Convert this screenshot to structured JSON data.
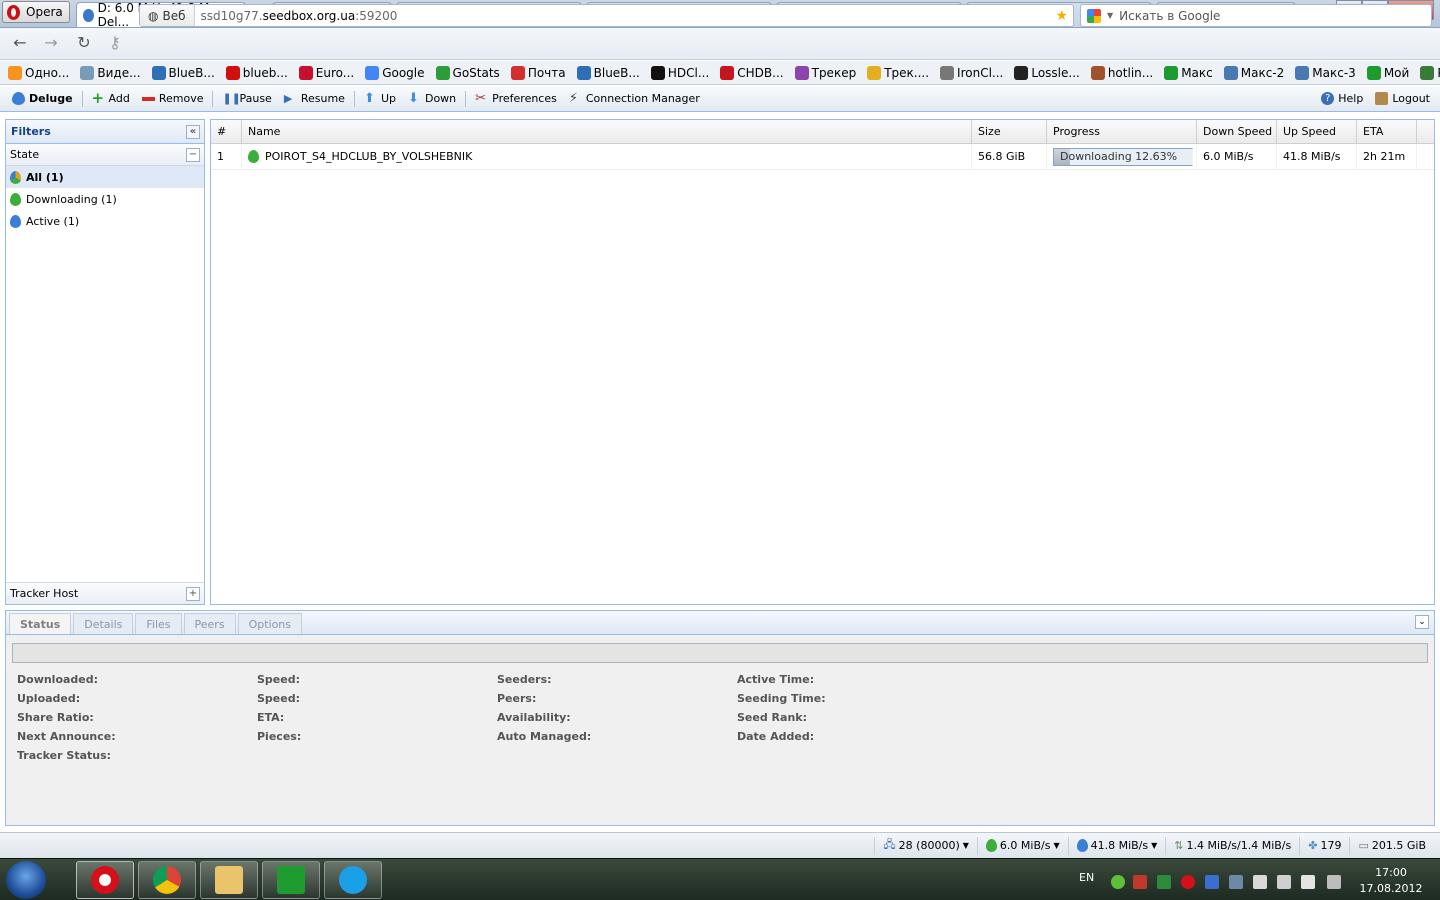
{
  "browser": {
    "menu_label": "Opera",
    "active_tab_title": "D: 6.0 M U: 41.8 M - Del...",
    "tab_close": "×",
    "address_badge": "Веб",
    "url_prefix": "ssd10g77.",
    "url_host": "seedbox.org.ua",
    "url_port": ":59200",
    "search_placeholder": "Искать в Google"
  },
  "bookmarks": [
    {
      "label": "Одно...",
      "color": "#f7931e"
    },
    {
      "label": "Виде...",
      "color": "#7a9bb8"
    },
    {
      "label": "BlueB...",
      "color": "#2f6fb8"
    },
    {
      "label": "blueb...",
      "color": "#d01010"
    },
    {
      "label": "Euro...",
      "color": "#c8102e"
    },
    {
      "label": "Google",
      "color": "#4285f4"
    },
    {
      "label": "GoStats",
      "color": "#2d9c3a"
    },
    {
      "label": "Почта",
      "color": "#d32f2f"
    },
    {
      "label": "BlueB...",
      "color": "#2f6fb8"
    },
    {
      "label": "HDCl...",
      "color": "#111111"
    },
    {
      "label": "CHDB...",
      "color": "#c4161c"
    },
    {
      "label": "Трекер",
      "color": "#8e44ad"
    },
    {
      "label": "Трек....",
      "color": "#e0b020"
    },
    {
      "label": "IronCl...",
      "color": "#777777"
    },
    {
      "label": "Lossle...",
      "color": "#222222"
    },
    {
      "label": "hotlin...",
      "color": "#a0522d"
    },
    {
      "label": "Макс",
      "color": "#1d9b2e"
    },
    {
      "label": "Макс-2",
      "color": "#4a78b0"
    },
    {
      "label": "Макс-3",
      "color": "#4a78b0"
    },
    {
      "label": "Мой",
      "color": "#1d9b2e"
    },
    {
      "label": "Pictur...",
      "color": "#3a7a3a"
    }
  ],
  "toolbar": {
    "brand": "Deluge",
    "add": "Add",
    "remove": "Remove",
    "pause": "Pause",
    "resume": "Resume",
    "up": "Up",
    "down": "Down",
    "preferences": "Preferences",
    "connection_manager": "Connection Manager",
    "help": "Help",
    "logout": "Logout"
  },
  "filters": {
    "title": "Filters",
    "state_label": "State",
    "items": [
      {
        "label": "All (1)",
        "selected": true
      },
      {
        "label": "Downloading (1)",
        "selected": false
      },
      {
        "label": "Active (1)",
        "selected": false
      }
    ],
    "tracker_host_label": "Tracker Host"
  },
  "grid": {
    "columns": [
      "#",
      "Name",
      "Size",
      "Progress",
      "Down Speed",
      "Up Speed",
      "ETA"
    ],
    "rows": [
      {
        "index": "1",
        "name": "POIROT_S4_HDCLUB_BY_VOLSHEBNIK",
        "size": "56.8 GiB",
        "progress_text": "Downloading 12.63%",
        "progress_value": 12.63,
        "down_speed": "6.0 MiB/s",
        "up_speed": "41.8 MiB/s",
        "eta": "2h 21m"
      }
    ]
  },
  "details": {
    "tabs": [
      "Status",
      "Details",
      "Files",
      "Peers",
      "Options"
    ],
    "active_tab": "Status",
    "fields": {
      "downloaded": "Downloaded:",
      "uploaded": "Uploaded:",
      "share_ratio": "Share Ratio:",
      "next_announce": "Next Announce:",
      "tracker_status": "Tracker Status:",
      "speed_down": "Speed:",
      "speed_up": "Speed:",
      "eta": "ETA:",
      "pieces": "Pieces:",
      "seeders": "Seeders:",
      "peers": "Peers:",
      "availability": "Availability:",
      "auto_managed": "Auto Managed:",
      "active_time": "Active Time:",
      "seeding_time": "Seeding Time:",
      "seed_rank": "Seed Rank:",
      "date_added": "Date Added:"
    }
  },
  "statusbar": {
    "connections": "28 (80000)",
    "down": "6.0 MiB/s",
    "up": "41.8 MiB/s",
    "protocol": "1.4 MiB/s/1.4 MiB/s",
    "dht": "179",
    "free_space": "201.5 GiB"
  },
  "taskbar": {
    "lang": "EN",
    "time": "17:00",
    "date": "17.08.2012"
  }
}
